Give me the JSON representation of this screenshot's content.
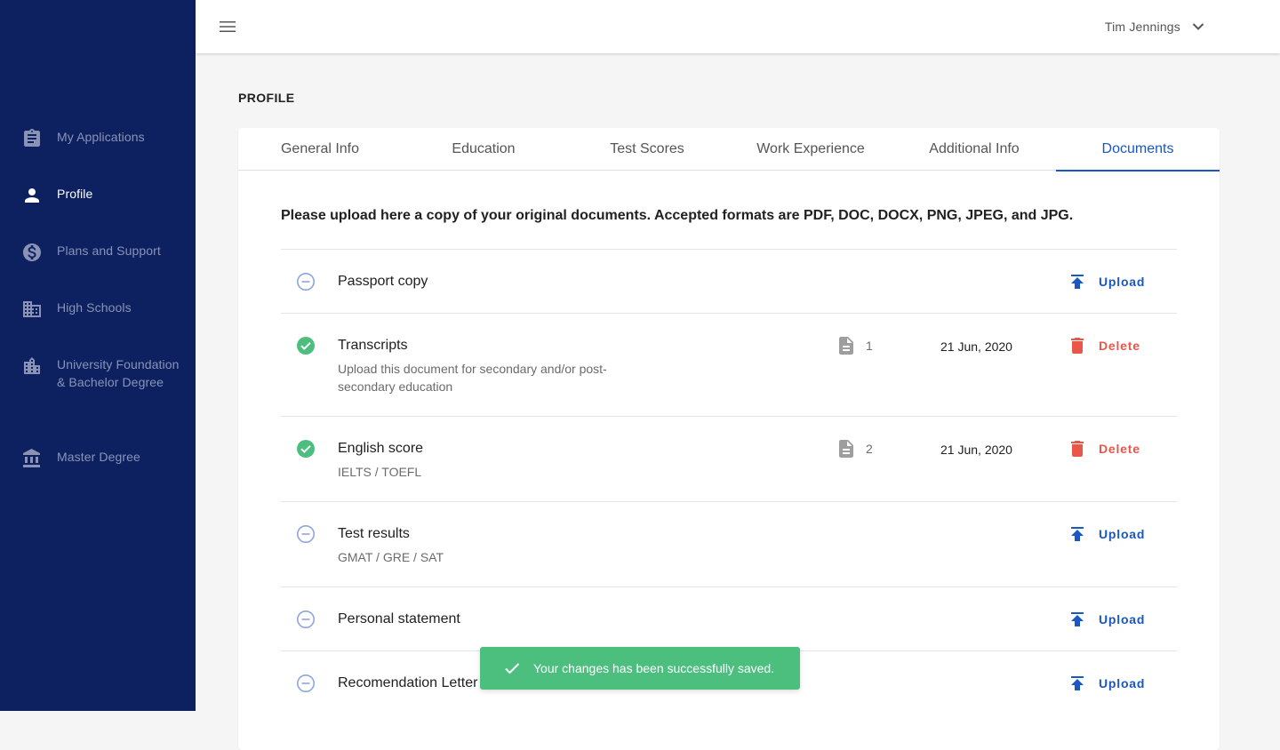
{
  "sidebar": {
    "items": [
      {
        "label": "My Applications",
        "icon": "clipboard-icon"
      },
      {
        "label": "Profile",
        "icon": "person-icon",
        "active": true
      },
      {
        "label": "Plans and Support",
        "icon": "dollar-circle-icon"
      },
      {
        "label": "High Schools",
        "icon": "building-icon"
      },
      {
        "label": "University Foundation & Bachelor Degree",
        "icon": "city-building-icon"
      },
      {
        "label": "Master Degree",
        "icon": "institution-icon"
      }
    ]
  },
  "header": {
    "user_name": "Tim Jennings"
  },
  "page": {
    "title": "PROFILE"
  },
  "tabs": [
    "General Info",
    "Education",
    "Test Scores",
    "Work Experience",
    "Additional Info",
    "Documents"
  ],
  "active_tab": "Documents",
  "documents": {
    "intro": "Please upload here a copy of your original documents. Accepted formats are PDF, DOC, DOCX, PNG, JPEG, and JPG.",
    "rows": [
      {
        "name": "Passport copy",
        "description": "",
        "status": "pending",
        "action": "Upload"
      },
      {
        "name": "Transcripts",
        "description": "Upload this document for secondary and/or post-secondary education",
        "status": "complete",
        "files": "1",
        "date": "21 Jun, 2020",
        "action": "Delete"
      },
      {
        "name": "English score",
        "description": "IELTS / TOEFL",
        "status": "complete",
        "files": "2",
        "date": "21 Jun, 2020",
        "action": "Delete"
      },
      {
        "name": "Test results",
        "description": "GMAT / GRE / SAT",
        "status": "pending",
        "action": "Upload"
      },
      {
        "name": "Personal statement",
        "description": "",
        "status": "pending",
        "action": "Upload"
      },
      {
        "name": "Recomendation Letter",
        "description": "",
        "status": "pending",
        "action": "Upload"
      }
    ]
  },
  "toast": {
    "message": "Your changes has been successfully saved."
  },
  "colors": {
    "sidebar_bg": "#0d2161",
    "accent_blue": "#1a56c4",
    "success_green": "#4cbf7f",
    "delete_red": "#e8574a"
  }
}
